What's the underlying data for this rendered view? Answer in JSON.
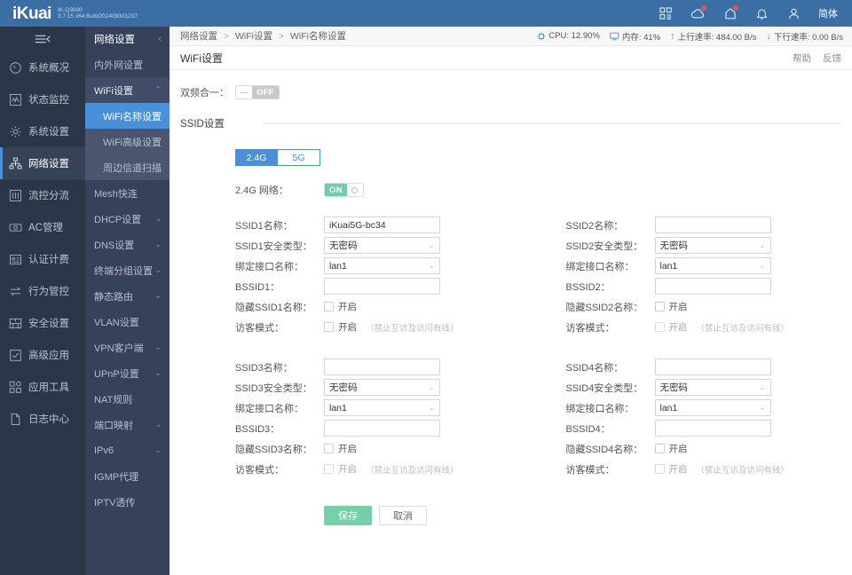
{
  "topbar": {
    "logo": "iKuai",
    "model": "IK-Q3000",
    "version": "3.7.15 x64 Build202409301237",
    "icons": [
      {
        "name": "apps-grid-icon",
        "badge": false
      },
      {
        "name": "cloud-icon",
        "badge": true
      },
      {
        "name": "home-shield-icon",
        "badge": true
      },
      {
        "name": "bell-icon",
        "badge": false
      },
      {
        "name": "user-icon",
        "badge": false
      }
    ],
    "language": "简体"
  },
  "sidebar_primary": {
    "collapse_label": "",
    "items": [
      {
        "label": "系统概况",
        "icon": "gauge-icon",
        "active": false
      },
      {
        "label": "状态监控",
        "icon": "monitor-wave-icon",
        "active": false
      },
      {
        "label": "系统设置",
        "icon": "gear-icon",
        "active": false
      },
      {
        "label": "网络设置",
        "icon": "network-tree-icon",
        "active": true
      },
      {
        "label": "流控分流",
        "icon": "sliders-icon",
        "active": false
      },
      {
        "label": "AC管理",
        "icon": "ap-icon",
        "active": false
      },
      {
        "label": "认证计费",
        "icon": "id-card-icon",
        "active": false
      },
      {
        "label": "行为管控",
        "icon": "arrows-exchange-icon",
        "active": false
      },
      {
        "label": "安全设置",
        "icon": "shield-grid-icon",
        "active": false
      },
      {
        "label": "高级应用",
        "icon": "check-square-icon",
        "active": false
      },
      {
        "label": "应用工具",
        "icon": "apps-tools-icon",
        "active": false
      },
      {
        "label": "日志中心",
        "icon": "document-icon",
        "active": false
      }
    ]
  },
  "sidebar_secondary": {
    "title": "网络设置",
    "collapse_caret": "‹",
    "items": [
      {
        "label": "内外网设置",
        "expandable": false,
        "state": ""
      },
      {
        "label": "WiFi设置",
        "expandable": true,
        "state": "expanded",
        "caret": "⌃"
      },
      {
        "label": "WiFi名称设置",
        "sub": true,
        "active": true
      },
      {
        "label": "WiFi高级设置",
        "sub": true,
        "active": false
      },
      {
        "label": "周边信道扫描",
        "sub": true,
        "active": false
      },
      {
        "label": "Mesh快连",
        "expandable": false,
        "state": ""
      },
      {
        "label": "DHCP设置",
        "expandable": true,
        "state": "collapsed",
        "caret": "⌄"
      },
      {
        "label": "DNS设置",
        "expandable": true,
        "state": "collapsed",
        "caret": "⌄"
      },
      {
        "label": "终端分组设置",
        "expandable": true,
        "state": "collapsed",
        "caret": "⌄"
      },
      {
        "label": "静态路由",
        "expandable": true,
        "state": "collapsed",
        "caret": "⌄"
      },
      {
        "label": "VLAN设置",
        "expandable": false,
        "state": ""
      },
      {
        "label": "VPN客户端",
        "expandable": true,
        "state": "collapsed",
        "caret": "⌄"
      },
      {
        "label": "UPnP设置",
        "expandable": true,
        "state": "collapsed",
        "caret": "⌄"
      },
      {
        "label": "NAT规则",
        "expandable": false,
        "state": ""
      },
      {
        "label": "端口映射",
        "expandable": true,
        "state": "collapsed",
        "caret": "⌄"
      },
      {
        "label": "IPv6",
        "expandable": true,
        "state": "collapsed",
        "caret": "⌄"
      },
      {
        "label": "IGMP代理",
        "expandable": false,
        "state": ""
      },
      {
        "label": "IPTV透传",
        "expandable": false,
        "state": ""
      }
    ]
  },
  "breadcrumb": {
    "parts": [
      "网络设置",
      "WiFi设置",
      "WiFi名称设置"
    ],
    "separator": ">"
  },
  "status": {
    "cpu": "CPU: 12.90%",
    "memory": "内存: 41%",
    "upload": "上行速率: 484.00 B/s",
    "download": "下行速率: 0.00 B/s",
    "up_arrow": "↑",
    "down_arrow": "↓"
  },
  "page": {
    "title": "WiFi设置",
    "help": "帮助",
    "feedback": "反馈"
  },
  "dual_band": {
    "label": "双频合一：",
    "state": "OFF",
    "on": false
  },
  "ssid_section": {
    "title": "SSID设置"
  },
  "band_tabs": [
    {
      "label": "2.4G",
      "active": true
    },
    {
      "label": "5G",
      "active": false
    }
  ],
  "network_toggle": {
    "label": "2.4G 网络：",
    "state": "ON",
    "on": true
  },
  "common": {
    "iface_label": "绑定接口名称：",
    "checkbox_enable": "开启",
    "guest_label": "访客模式：",
    "guest_hint": "（禁止互访及访问有线）"
  },
  "ssid_blocks": [
    {
      "name_label": "SSID1名称：",
      "name_value": "iKuai5G-bc34",
      "name_placeholder": "",
      "sec_label": "SSID1安全类型：",
      "sec_value": "无密码",
      "iface_value": "lan1",
      "bssid_label": "BSSID1：",
      "bssid_value": "",
      "hide_label": "隐藏SSID1名称：",
      "hide_checked": false,
      "guest_checked": false,
      "guest_disabled": false
    },
    {
      "name_label": "SSID2名称：",
      "name_value": "",
      "name_placeholder": "",
      "sec_label": "SSID2安全类型：",
      "sec_value": "无密码",
      "iface_value": "lan1",
      "bssid_label": "BSSID2：",
      "bssid_value": "",
      "hide_label": "隐藏SSID2名称：",
      "hide_checked": false,
      "guest_checked": false,
      "guest_disabled": true
    },
    {
      "name_label": "SSID3名称：",
      "name_value": "",
      "name_placeholder": "",
      "sec_label": "SSID3安全类型：",
      "sec_value": "无密码",
      "iface_value": "lan1",
      "bssid_label": "BSSID3：",
      "bssid_value": "",
      "hide_label": "隐藏SSID3名称：",
      "hide_checked": false,
      "guest_checked": false,
      "guest_disabled": true
    },
    {
      "name_label": "SSID4名称：",
      "name_value": "",
      "name_placeholder": "",
      "sec_label": "SSID4安全类型：",
      "sec_value": "无密码",
      "iface_value": "lan1",
      "bssid_label": "BSSID4：",
      "bssid_value": "",
      "hide_label": "隐藏SSID4名称：",
      "hide_checked": false,
      "guest_checked": false,
      "guest_disabled": true
    }
  ],
  "buttons": {
    "save": "保存",
    "cancel": "取消"
  },
  "colors": {
    "topbar": "#3b6ea5",
    "sidebar1": "#2b3648",
    "sidebar2": "#36415a",
    "accent_blue": "#4a90d9",
    "accent_green": "#6ecfa5",
    "save_green": "#76cfa6",
    "badge_red": "#e8534f"
  }
}
